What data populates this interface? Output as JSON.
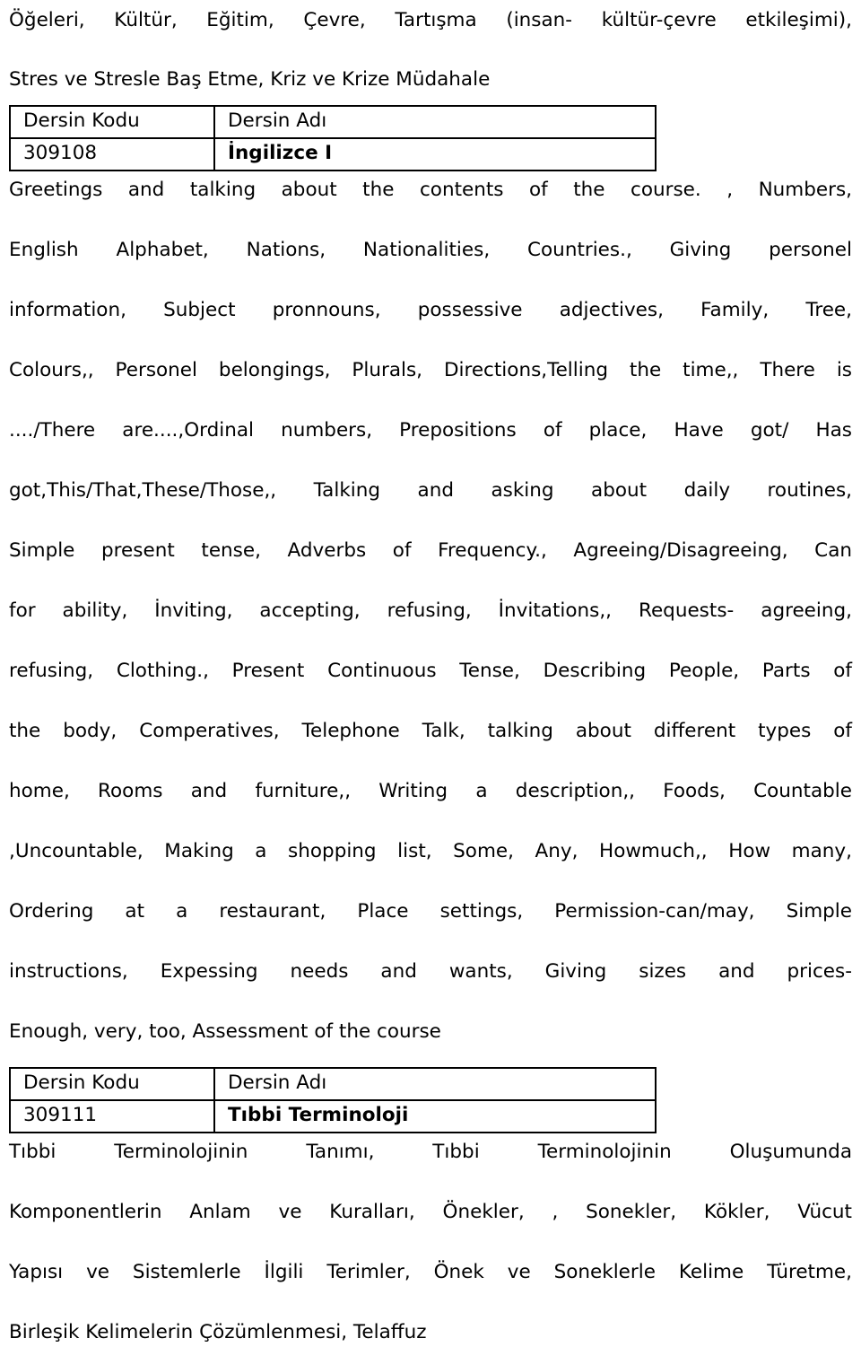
{
  "document": {
    "language": "tr",
    "heading_paragraph": "Öğeleri, Kültür, Eğitim, Çevre, Tartışma (insan- kültür-çevre etkileşimi), Stres ve Stresle Baş Etme, Kriz ve Krize Müdahale",
    "heading_line_1": "Öğeleri, Kültür, Eğitim, Çevre, Tartışma (insan- kültür-çevre etkileşimi),",
    "heading_line_2": "Stres ve Stresle Baş Etme, Kriz ve Krize Müdahale"
  },
  "table_headers": {
    "code": "Dersin Kodu",
    "name": "Dersin Adı"
  },
  "courses": [
    {
      "code": "309108",
      "name": "İngilizce I",
      "description_lines": [
        "Greetings and talking about the contents of the course. , Numbers,",
        "English Alphabet, Nations, Nationalities, Countries., Giving personel",
        "information, Subject pronnouns, possessive adjectives, Family, Tree,",
        "Colours,, Personel belongings, Plurals, Directions,Telling the time,, There is",
        "..../There are....,Ordinal numbers, Prepositions of place, Have got/ Has",
        "got,This/That,These/Those,, Talking and asking about daily routines,",
        "Simple present tense, Adverbs of Frequency., Agreeing/Disagreeing, Can",
        "for ability, İnviting, accepting, refusing, İnvitations,, Requests- agreeing,",
        "refusing, Clothing., Present Continuous Tense, Describing People, Parts of",
        "the body, Comperatives, Telephone Talk, talking about different types of",
        "home, Rooms and furniture,, Writing a description,, Foods, Countable",
        ",Uncountable, Making a shopping list, Some, Any, Howmuch,, How many,",
        "Ordering at a restaurant, Place settings, Permission-can/may, Simple",
        "instructions, Expessing needs and wants, Giving sizes and prices-",
        "Enough, very, too, Assessment of the course"
      ]
    },
    {
      "code": "309111",
      "name": "Tıbbi Terminoloji",
      "description_lines": [
        "Tıbbi Terminolojinin Tanımı, Tıbbi Terminolojinin Oluşumunda",
        "Komponentlerin Anlam ve Kuralları, Önekler, , Sonekler, Kökler, Vücut",
        "Yapısı ve Sistemlerle İlgili Terimler, Önek ve Soneklerle Kelime Türetme,",
        "Birleşik Kelimelerin Çözümlenmesi, Telaffuz"
      ]
    }
  ]
}
